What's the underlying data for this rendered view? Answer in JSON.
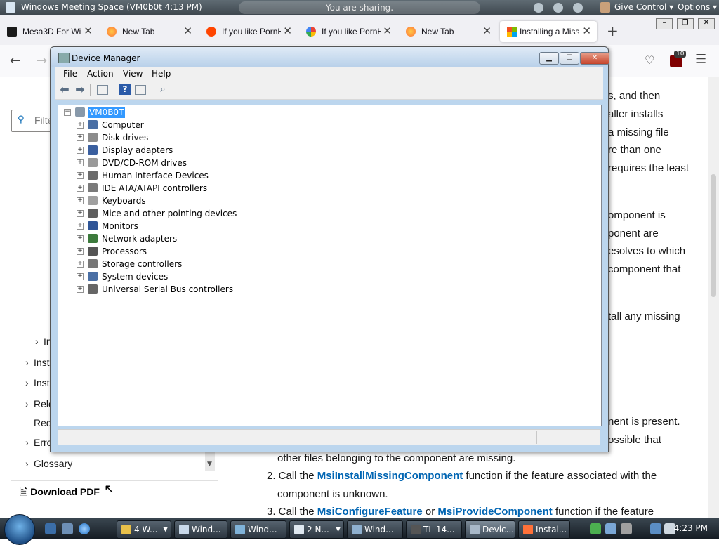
{
  "meeting_bar": {
    "title": "Windows Meeting Space (VM0b0t 4:13 PM)",
    "status": "You are sharing.",
    "give_control": "Give Control",
    "options": "Options"
  },
  "browser": {
    "tabs": [
      {
        "label": "Mesa3D For Wir",
        "favicon": "mesa3d-icon",
        "color": "#1a1a1a"
      },
      {
        "label": "New Tab",
        "favicon": "firefox-icon",
        "color": "#ff7139"
      },
      {
        "label": "If you like PornH",
        "favicon": "reddit-icon",
        "color": "#ff4500"
      },
      {
        "label": "If you like PornH",
        "favicon": "google-icon",
        "color": "#4285f4"
      },
      {
        "label": "New Tab",
        "favicon": "firefox-icon",
        "color": "#ff7139"
      },
      {
        "label": "Installing a Miss",
        "favicon": "microsoft-icon",
        "color": "#f25022",
        "active": true
      }
    ],
    "badge_count": "10",
    "filter_placeholder": "Filte"
  },
  "page": {
    "toc": [
      {
        "label": "In",
        "has_chevron": true
      },
      {
        "label": "Inst",
        "has_chevron": true
      },
      {
        "label": "Inst",
        "has_chevron": true
      },
      {
        "label": "Rele",
        "has_chevron": true
      },
      {
        "label": "Red",
        "has_chevron": false
      },
      {
        "label": "Erro",
        "has_chevron": true
      },
      {
        "label": "Glossary",
        "has_chevron": true
      }
    ],
    "download_pdf": "Download PDF",
    "fragments": [
      "s, and then",
      "aller installs",
      "a missing file",
      "re than one",
      "requires the least",
      "omponent is",
      "ponent are",
      "esolves to which",
      "component that",
      "tall any missing",
      "nent is present.",
      "ossible that"
    ],
    "line_other_files": "other files belonging to the component are missing.",
    "step2_prefix": "2. Call the ",
    "step2_link": "MsiInstallMissingComponent",
    "step2_suffix": " function if the feature associated with the",
    "step2_cont": "component is unknown.",
    "step3_prefix": "3. Call the ",
    "step3_link1": "MsiConfigureFeature",
    "step3_mid": " or ",
    "step3_link2": "MsiProvideComponent",
    "step3_suffix": " function if the feature"
  },
  "device_manager": {
    "title": "Device Manager",
    "menu": [
      "File",
      "Action",
      "View",
      "Help"
    ],
    "root": "VM0B0T",
    "items": [
      {
        "label": "Computer",
        "icon": "computer-icon",
        "color": "#4a6fa5"
      },
      {
        "label": "Disk drives",
        "icon": "disk-drive-icon",
        "color": "#8c8c8c"
      },
      {
        "label": "Display adapters",
        "icon": "display-adapter-icon",
        "color": "#3a5f9f"
      },
      {
        "label": "DVD/CD-ROM drives",
        "icon": "dvd-drive-icon",
        "color": "#9a9a9a"
      },
      {
        "label": "Human Interface Devices",
        "icon": "hid-icon",
        "color": "#6b6b6b"
      },
      {
        "label": "IDE ATA/ATAPI controllers",
        "icon": "ide-controller-icon",
        "color": "#7a7a7a"
      },
      {
        "label": "Keyboards",
        "icon": "keyboard-icon",
        "color": "#a0a0a0"
      },
      {
        "label": "Mice and other pointing devices",
        "icon": "mouse-icon",
        "color": "#5e5e5e"
      },
      {
        "label": "Monitors",
        "icon": "monitor-icon",
        "color": "#2f5597"
      },
      {
        "label": "Network adapters",
        "icon": "network-adapter-icon",
        "color": "#3c7a3c"
      },
      {
        "label": "Processors",
        "icon": "processor-icon",
        "color": "#555555"
      },
      {
        "label": "Storage controllers",
        "icon": "storage-controller-icon",
        "color": "#777777"
      },
      {
        "label": "System devices",
        "icon": "system-devices-icon",
        "color": "#4a6fa5"
      },
      {
        "label": "Universal Serial Bus controllers",
        "icon": "usb-icon",
        "color": "#666666"
      }
    ]
  },
  "taskbar": {
    "tasks": [
      {
        "label": "4 W...",
        "icon": "folder-icon",
        "color": "#e8c04a",
        "dropdown": true
      },
      {
        "label": "Wind...",
        "icon": "meeting-space-icon",
        "color": "#c9d9ea"
      },
      {
        "label": "Wind...",
        "icon": "windows-app-icon",
        "color": "#7fb2d8"
      },
      {
        "label": "2 N...",
        "icon": "notepad-icon",
        "color": "#dfe8f0",
        "dropdown": true
      },
      {
        "label": "Wind...",
        "icon": "windows-app-icon",
        "color": "#8fb0cf"
      },
      {
        "label": "TL 14...",
        "icon": "terminal-icon",
        "color": "#555555"
      },
      {
        "label": "Devic...",
        "icon": "device-manager-icon",
        "color": "#a8b8c8",
        "active": true
      },
      {
        "label": "Instal...",
        "icon": "firefox-icon",
        "color": "#ff7139"
      }
    ],
    "clock": "4:23 PM"
  }
}
